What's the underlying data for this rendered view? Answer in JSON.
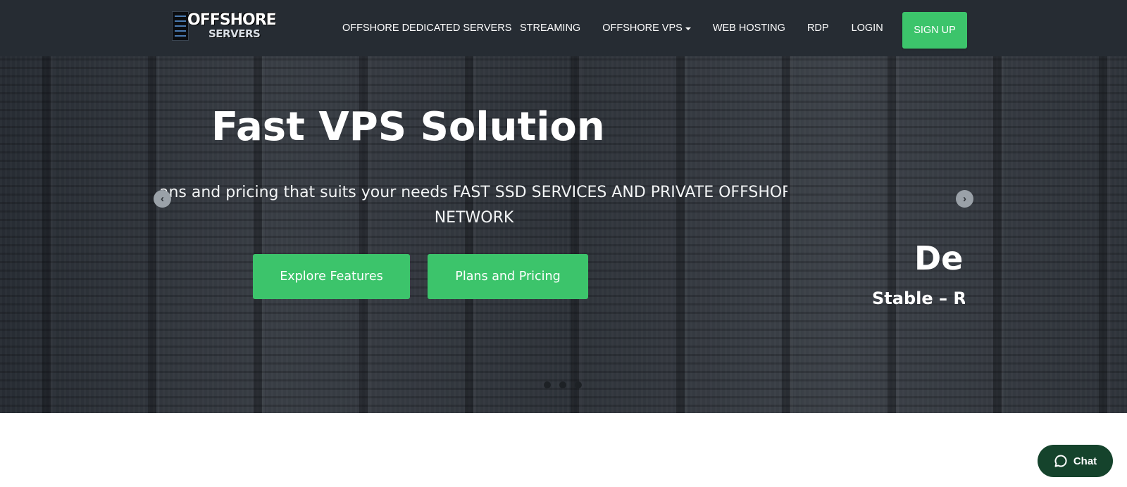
{
  "header": {
    "logo": {
      "line1": "OFFSHORE",
      "line2": "SERVERS"
    },
    "nav": [
      {
        "label": "OFFSHORE DEDICATED SERVERS"
      },
      {
        "label": "STREAMING"
      },
      {
        "label": "OFFSHORE VPS"
      },
      {
        "label": "WEB HOSTING"
      },
      {
        "label": "RDP"
      },
      {
        "label": "LOGIN"
      }
    ],
    "signup_label": "SIGN UP"
  },
  "hero": {
    "slide_title": "Fast VPS Solution",
    "slide_subtitle": "Plans and pricing that suits your needs FAST SSD SERVICES AND PRIVATE OFFSHORE NETWORK",
    "buttons": {
      "explore": "Explore Features",
      "pricing": "Plans and Pricing"
    },
    "next_slide": {
      "title": "De",
      "subtitle": "Stable – Re"
    },
    "active_dot_index": 1,
    "dot_count": 3
  },
  "chat": {
    "label": "Chat"
  },
  "colors": {
    "accent": "#3cc46b",
    "header_bg": "#262c33",
    "chat_bg": "#15432c"
  }
}
